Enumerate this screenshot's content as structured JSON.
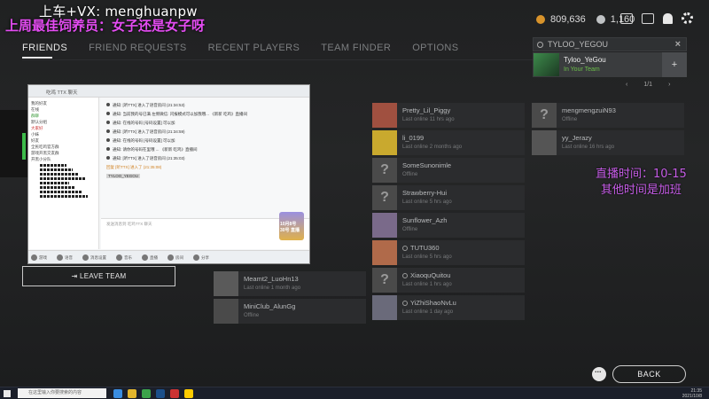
{
  "overlay": {
    "line1": "上车+VX: menghuanpw",
    "line2": "上周最佳饲养员：女子还是女子呀",
    "right": "直播时间：10-15\n其他时间是加班"
  },
  "tabs": [
    {
      "label": "FRIENDS",
      "active": true
    },
    {
      "label": "FRIEND REQUESTS"
    },
    {
      "label": "RECENT PLAYERS"
    },
    {
      "label": "TEAM FINDER"
    },
    {
      "label": "OPTIONS"
    }
  ],
  "currency": {
    "coins": "809,636",
    "gold": "1,160"
  },
  "search": {
    "value": "TYLOO_YEGOU",
    "clear": "×"
  },
  "result": {
    "name": "Tyloo_YeGou",
    "status": "In Your Team",
    "add_icon": "add-user-icon"
  },
  "pager": {
    "prev": "‹",
    "page": "1/1",
    "next": "›"
  },
  "friends_col1": [
    {
      "name": "Pretty_Lil_Piggy",
      "status": "Last online 11 hrs ago",
      "avatar": "img",
      "av_color": "#a05040"
    },
    {
      "name": "li_0199",
      "status": "Last online 2 months ago",
      "avatar": "img",
      "av_color": "#c9a92e"
    },
    {
      "name": "SomeSunonimle",
      "status": "Offline",
      "avatar": "?"
    },
    {
      "name": "Strawberry-Hui",
      "status": "Last online 5 hrs ago",
      "avatar": "?"
    },
    {
      "name": "Sunflower_Azh",
      "status": "Offline",
      "avatar": "img",
      "av_color": "#7a6a8a"
    },
    {
      "name": "TUTU360",
      "status": "Last online 5 hrs ago",
      "avatar": "img",
      "av_color": "#b06a4a",
      "dot": true
    },
    {
      "name": "XiaoquQuitou",
      "status": "Last online 1 hrs ago",
      "avatar": "?",
      "dot": true
    },
    {
      "name": "YiZhiShaoNvLu",
      "status": "Last online 1 day ago",
      "avatar": "img",
      "av_color": "#6a6a7a",
      "dot": true
    }
  ],
  "friends_col0": [
    {
      "name": "Meamt2_LuoHn13",
      "status": "Last online 1 month ago",
      "avatar": "img",
      "av_color": "#5a5a5a"
    },
    {
      "name": "MiniClub_AlunGg",
      "status": "Offline",
      "avatar": "img",
      "av_color": "#4a4a4a"
    }
  ],
  "friends_col2": [
    {
      "name": "mengmengzuiN93",
      "status": "Offline",
      "avatar": "?"
    },
    {
      "name": "yy_Jerazy",
      "status": "Last online 16 hrs ago",
      "avatar": "img",
      "av_color": "#555"
    }
  ],
  "leave_team": "LEAVE TEAM",
  "back": "BACK",
  "qq": {
    "title": "吃鸡 TTX 聊天",
    "side_lines": [
      "我的好友",
      "在线",
      "群聊",
      "默认分组",
      "大家好",
      "小妹",
      "好友",
      "全民吃鸡官方群",
      "游戏开黑交友群",
      "开黑小分队"
    ],
    "messages": [
      "通知: [听TTX] 进入了语音房间 (21:34:53)",
      "通知: 当前我的号已满 左侧微信: 闪报模式可以加我哦... 《新新 吃鸡》直播间",
      "通知: 在线的号码 [号码设置] 可以加",
      "通知: [听TTX] 进入了语音房间 (21:34:59)",
      "通知: 在线的号码 [号码设置] 可以加",
      "通知: 请你的号码在里哦 ... 《新新 吃鸡》直播间",
      "通知: [听TTX] 进入了语音房间 (21:35:03)"
    ],
    "reply": "回复 [听TTX] 进入了 (21:35:08)",
    "highlight": "TYLOO_YEGOU",
    "input_hint": "发送消息到 吃鸡TTX 聊天",
    "sticker": "10月8号\n30号 直播",
    "bottom": [
      "游戏",
      "语音",
      "消息设置",
      "音乐",
      "直播",
      "房间",
      "分享"
    ]
  },
  "taskbar": {
    "search": "在这里输入你要搜索的内容",
    "time": "21:35",
    "date": "2021/10/8"
  }
}
